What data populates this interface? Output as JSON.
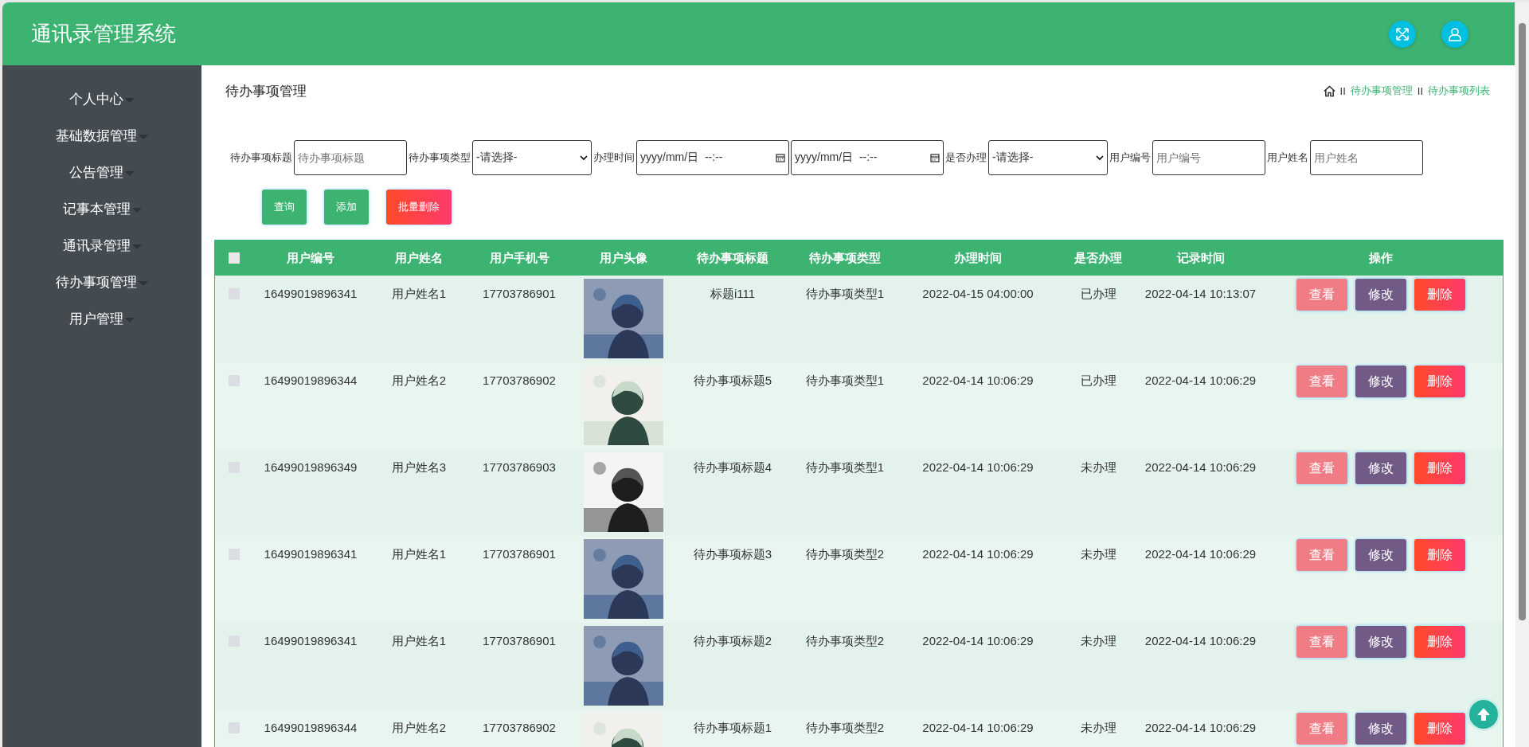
{
  "header": {
    "title": "通讯录管理系统"
  },
  "sidebar": {
    "items": [
      {
        "label": "个人中心"
      },
      {
        "label": "基础数据管理"
      },
      {
        "label": "公告管理"
      },
      {
        "label": "记事本管理"
      },
      {
        "label": "通讯录管理"
      },
      {
        "label": "待办事项管理"
      },
      {
        "label": "用户管理"
      }
    ]
  },
  "page_title": "待办事项管理",
  "breadcrumb": [
    {
      "separator": "II",
      "label": "待办事项管理"
    },
    {
      "separator": "II",
      "label": "待办事项列表"
    }
  ],
  "filters": [
    {
      "label": "待办事项标题",
      "kind": "text",
      "placeholder": "待办事项标题"
    },
    {
      "label": "待办事项类型",
      "kind": "select",
      "value": "-请选择-"
    },
    {
      "label": "办理时间",
      "kind": "datetime",
      "value": "yyyy/mm/日  --:--"
    },
    {
      "kind": "datetime",
      "value": "yyyy/mm/日  --:--"
    },
    {
      "label": "是否办理",
      "kind": "select",
      "value": "-请选择-"
    },
    {
      "label": "用户编号",
      "kind": "text",
      "placeholder": "用户编号"
    },
    {
      "label": "用户姓名",
      "kind": "text",
      "placeholder": "用户姓名"
    }
  ],
  "actions": [
    {
      "label": "查询",
      "kind": "query"
    },
    {
      "label": "添加",
      "kind": "add"
    },
    {
      "label": "批量删除",
      "kind": "delete"
    }
  ],
  "table": {
    "select_all": {
      "checked": false
    },
    "columns": [
      "用户编号",
      "用户姓名",
      "用户手机号",
      "用户头像",
      "待办事项标题",
      "待办事项类型",
      "办理时间",
      "是否办理",
      "记录时间",
      "操作"
    ],
    "rows": [
      {
        "checked": false,
        "cells": [
          "16499019896341",
          "用户姓名1",
          "17703786901",
          {
            "kind": "picture"
          },
          "标题i111",
          "待办事项类型1",
          "2022-04-15 04:00:00",
          "已办理",
          "2022-04-14 10:13:07"
        ],
        "buttons": [
          {
            "label": "查看",
            "kind": "view"
          },
          {
            "label": "修改",
            "kind": "edit"
          },
          {
            "label": "删除",
            "kind": "delete"
          }
        ]
      },
      {
        "checked": false,
        "cells": [
          "16499019896344",
          "用户姓名2",
          "17703786902",
          {
            "kind": "picture"
          },
          "待办事项标题5",
          "待办事项类型1",
          "2022-04-14 10:06:29",
          "已办理",
          "2022-04-14 10:06:29"
        ],
        "buttons": [
          {
            "label": "查看",
            "kind": "view"
          },
          {
            "label": "修改",
            "kind": "edit"
          },
          {
            "label": "删除",
            "kind": "delete"
          }
        ]
      },
      {
        "checked": false,
        "cells": [
          "16499019896349",
          "用户姓名3",
          "17703786903",
          {
            "kind": "picture"
          },
          "待办事项标题4",
          "待办事项类型1",
          "2022-04-14 10:06:29",
          "未办理",
          "2022-04-14 10:06:29"
        ],
        "buttons": [
          {
            "label": "查看",
            "kind": "view"
          },
          {
            "label": "修改",
            "kind": "edit"
          },
          {
            "label": "删除",
            "kind": "delete"
          }
        ]
      },
      {
        "checked": false,
        "cells": [
          "16499019896341",
          "用户姓名1",
          "17703786901",
          {
            "kind": "picture"
          },
          "待办事项标题3",
          "待办事项类型2",
          "2022-04-14 10:06:29",
          "未办理",
          "2022-04-14 10:06:29"
        ],
        "buttons": [
          {
            "label": "查看",
            "kind": "view"
          },
          {
            "label": "修改",
            "kind": "edit"
          },
          {
            "label": "删除",
            "kind": "delete"
          }
        ]
      },
      {
        "checked": false,
        "cells": [
          "16499019896341",
          "用户姓名1",
          "17703786901",
          {
            "kind": "picture"
          },
          "待办事项标题2",
          "待办事项类型2",
          "2022-04-14 10:06:29",
          "未办理",
          "2022-04-14 10:06:29"
        ],
        "buttons": [
          {
            "label": "查看",
            "kind": "view"
          },
          {
            "label": "修改",
            "kind": "edit"
          },
          {
            "label": "删除",
            "kind": "delete"
          }
        ]
      },
      {
        "checked": false,
        "cells": [
          "16499019896344",
          "用户姓名2",
          "17703786902",
          {
            "kind": "picture"
          },
          "待办事项标题1",
          "待办事项类型2",
          "2022-04-14 10:06:29",
          "未办理",
          "2022-04-14 10:06:29"
        ],
        "buttons": [
          {
            "label": "查看",
            "kind": "view"
          },
          {
            "label": "修改",
            "kind": "edit"
          },
          {
            "label": "删除",
            "kind": "delete"
          }
        ]
      }
    ]
  }
}
